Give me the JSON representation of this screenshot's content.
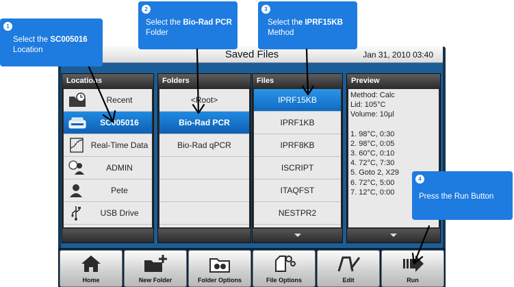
{
  "header": {
    "title": "Saved Files",
    "datetime": "Jan 31, 2010 03:40"
  },
  "locations": {
    "heading": "Locations",
    "items": [
      {
        "label": "Recent",
        "icon": "recent-folder-icon",
        "selected": false
      },
      {
        "label": "SC005016",
        "icon": "instrument-icon",
        "selected": true
      },
      {
        "label": "Real-Time Data",
        "icon": "realtime-data-icon",
        "selected": false
      },
      {
        "label": "ADMIN",
        "icon": "admin-users-icon",
        "selected": false
      },
      {
        "label": "Pete",
        "icon": "user-icon",
        "selected": false
      },
      {
        "label": "USB Drive",
        "icon": "usb-icon",
        "selected": false
      }
    ]
  },
  "folders": {
    "heading": "Folders",
    "items": [
      {
        "label": "<Root>",
        "selected": false
      },
      {
        "label": "Bio-Rad PCR",
        "selected": true
      },
      {
        "label": "Bio-Rad qPCR",
        "selected": false
      }
    ]
  },
  "files": {
    "heading": "Files",
    "items": [
      {
        "label": "IPRF15KB",
        "selected": true
      },
      {
        "label": "IPRF1KB",
        "selected": false
      },
      {
        "label": "IPRF8KB",
        "selected": false
      },
      {
        "label": "ISCRIPT",
        "selected": false
      },
      {
        "label": "ITAQFST",
        "selected": false
      },
      {
        "label": "NESTPR2",
        "selected": false
      }
    ]
  },
  "preview": {
    "heading": "Preview",
    "method": "Method: Calc",
    "lid": "Lid: 105°C",
    "volume": "Volume: 10µl",
    "steps": [
      "1. 98°C, 0:30",
      "2. 98°C, 0:05",
      "3. 60°C, 0:10",
      "4. 72°C, 7:30",
      "5. Goto 2, X29",
      "6. 72°C, 5:00",
      "7. 12°C, 0:00"
    ]
  },
  "toolbar": {
    "home": "Home",
    "new_folder": "New Folder",
    "folder_options": "Folder Options",
    "file_options": "File Options",
    "edit": "Edit",
    "run": "Run"
  },
  "callouts": {
    "c1": {
      "num": "1",
      "pre": "Select the ",
      "bold": "SC005016",
      "post": "Location"
    },
    "c2": {
      "num": "2",
      "pre": "Select the ",
      "bold": "Bio-Rad PCR",
      "post": "Folder"
    },
    "c3": {
      "num": "3",
      "pre": "Select th",
      "bold": "e IPRF15KB",
      "post": "Method"
    },
    "c4": {
      "num": "4",
      "text": "Press the Run Button"
    }
  },
  "colors": {
    "accent": "#1e7be0",
    "selected_row": "#1577d0",
    "frame": "#1c5d97"
  }
}
